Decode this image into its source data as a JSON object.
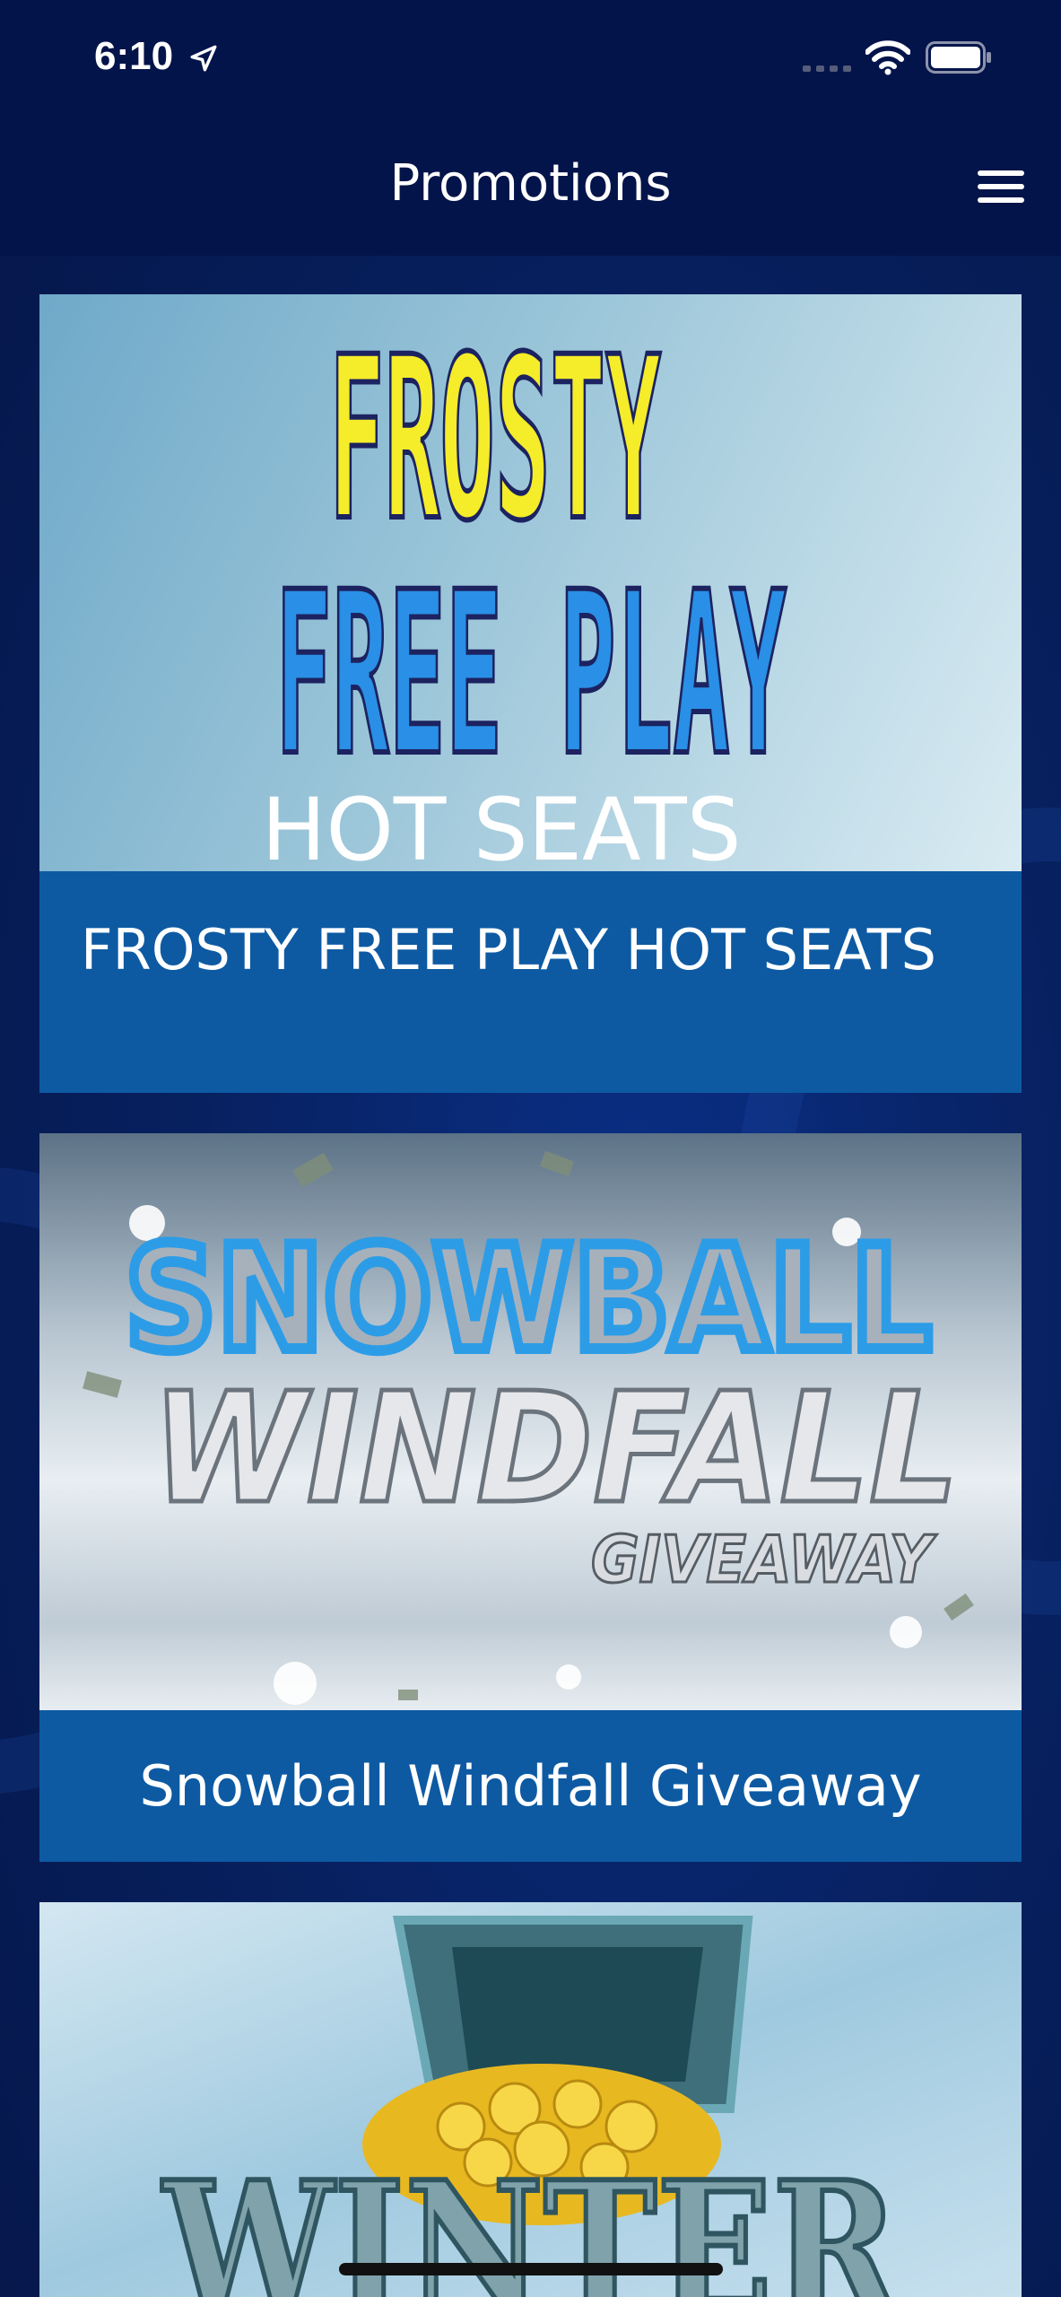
{
  "status_bar": {
    "time": "6:10"
  },
  "header": {
    "title": "Promotions"
  },
  "promotions": [
    {
      "title": "FROSTY FREE PLAY HOT SEATS",
      "art_lines": [
        "FROSTY",
        "FREE PLAY",
        "HOT SEATS"
      ]
    },
    {
      "title": "Snowball Windfall Giveaway",
      "art_lines": [
        "SNOWBALL",
        "WINDFALL",
        "GIVEAWAY"
      ]
    },
    {
      "title": "",
      "art_lines": [
        "WINTER"
      ]
    }
  ],
  "colors": {
    "bar_background": "#03144a",
    "caption_background": "#0d5aa3",
    "accent_yellow": "#f5ec2a",
    "accent_blue": "#2a8fe6"
  }
}
